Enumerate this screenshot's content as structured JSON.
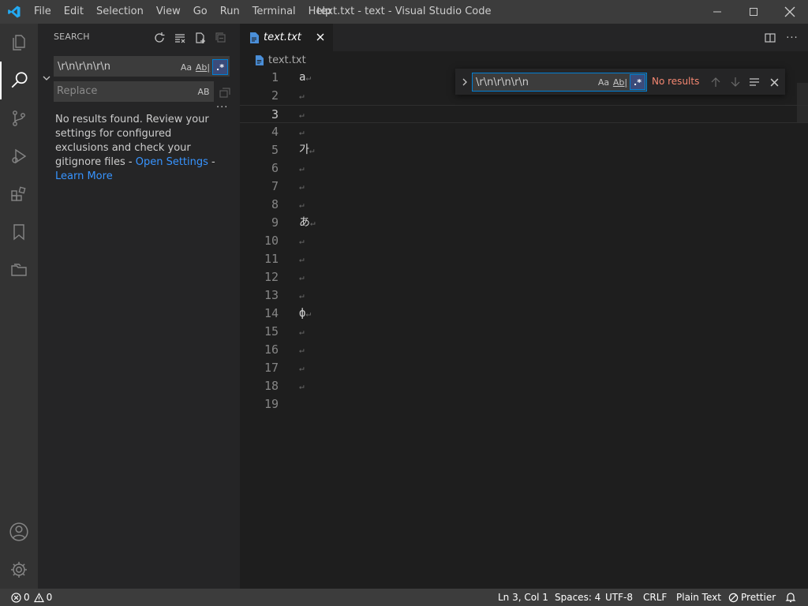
{
  "window": {
    "title": "text.txt - text - Visual Studio Code"
  },
  "menu": [
    "File",
    "Edit",
    "Selection",
    "View",
    "Go",
    "Run",
    "Terminal",
    "Help"
  ],
  "sidebar": {
    "header": "SEARCH",
    "search_value": "\\r\\n\\r\\n\\r\\n",
    "search_opts": {
      "case": "Aa",
      "word": "Ab|",
      "regex": ".*"
    },
    "replace_placeholder": "Replace",
    "preserve_case": "AB",
    "no_results_text": "No results found. Review your settings for configured exclusions and check your gitignore files - ",
    "open_settings": "Open Settings",
    "separator": " - ",
    "learn_more": "Learn More"
  },
  "tab": {
    "label": "text.txt"
  },
  "breadcrumb": {
    "file": "text.txt"
  },
  "editor": {
    "current_line": 3,
    "lines": [
      {
        "num": "1",
        "text": "a",
        "eol": "↵"
      },
      {
        "num": "2",
        "text": "",
        "eol": "↵"
      },
      {
        "num": "3",
        "text": "",
        "eol": "↵"
      },
      {
        "num": "4",
        "text": "",
        "eol": "↵"
      },
      {
        "num": "5",
        "text": "가",
        "eol": "↵"
      },
      {
        "num": "6",
        "text": "",
        "eol": "↵"
      },
      {
        "num": "7",
        "text": "",
        "eol": "↵"
      },
      {
        "num": "8",
        "text": "",
        "eol": "↵"
      },
      {
        "num": "9",
        "text": "あ",
        "eol": "↵"
      },
      {
        "num": "10",
        "text": "",
        "eol": "↵"
      },
      {
        "num": "11",
        "text": "",
        "eol": "↵"
      },
      {
        "num": "12",
        "text": "",
        "eol": "↵"
      },
      {
        "num": "13",
        "text": "",
        "eol": "↵"
      },
      {
        "num": "14",
        "text": "ф",
        "eol": "↵"
      },
      {
        "num": "15",
        "text": "",
        "eol": "↵"
      },
      {
        "num": "16",
        "text": "",
        "eol": "↵"
      },
      {
        "num": "17",
        "text": "",
        "eol": "↵"
      },
      {
        "num": "18",
        "text": "",
        "eol": "↵"
      },
      {
        "num": "19",
        "text": "",
        "eol": ""
      }
    ]
  },
  "find": {
    "value": "\\r\\n\\r\\n\\r\\n",
    "case": "Aa",
    "word": "Ab|",
    "regex": ".*",
    "status": "No results"
  },
  "status": {
    "errors": "0",
    "warnings": "0",
    "position": "Ln 3, Col 1",
    "spaces": "Spaces: 4",
    "encoding": "UTF-8",
    "eol": "CRLF",
    "language": "Plain Text",
    "prettier": "Prettier"
  },
  "colors": {
    "accent": "#007fd4",
    "link": "#3794ff",
    "error": "#f48771"
  }
}
